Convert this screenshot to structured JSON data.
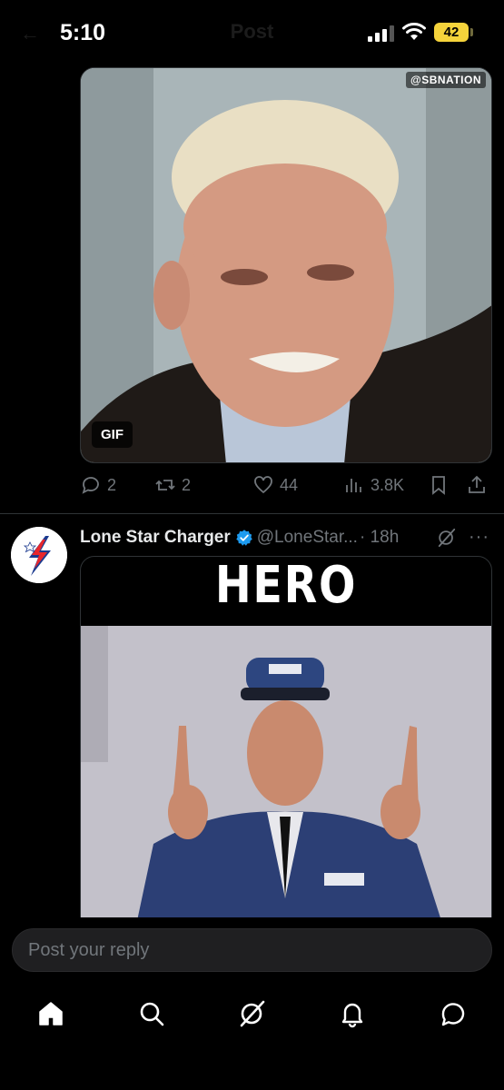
{
  "status_bar": {
    "time": "5:10",
    "battery": "42",
    "ghost_title": "Post"
  },
  "post1": {
    "watermark": "@SBNATION",
    "gif_badge": "GIF",
    "replies": "2",
    "reposts": "2",
    "likes": "44",
    "views": "3.8K"
  },
  "post2": {
    "display_name": "Lone Star Charger",
    "handle": "@LoneStar...",
    "time": "· 18h",
    "more": "···",
    "media_caption": "HERO"
  },
  "reply": {
    "placeholder": "Post your reply"
  },
  "nav": {
    "items": [
      "home-icon",
      "search-icon",
      "grok-icon",
      "notifications-icon",
      "messages-icon"
    ]
  },
  "colors": {
    "background": "#000000",
    "muted": "#71767b",
    "verified": "#1d9bf0",
    "battery": "#f5d33b"
  }
}
